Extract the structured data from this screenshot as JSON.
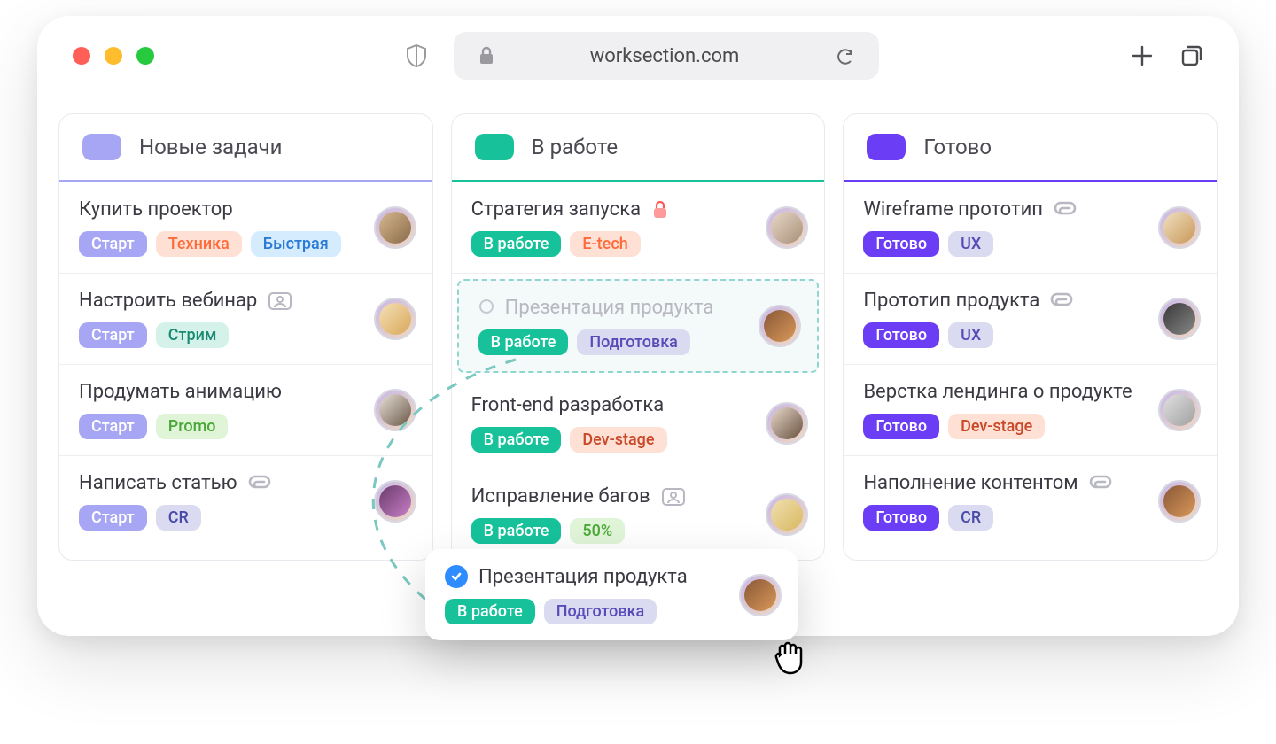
{
  "browser": {
    "url": "worksection.com"
  },
  "columns": [
    {
      "id": "new",
      "title": "Новые задачи",
      "chip_color": "#a6a6f5",
      "border_color": "#a6a6f5",
      "cards": [
        {
          "title": "Купить проектор",
          "tags": [
            {
              "text": "Старт",
              "bg": "#a6a6f5",
              "fg": "#ffffff"
            },
            {
              "text": "Техника",
              "bg": "#ffe0d4",
              "fg": "#ff6a3a"
            },
            {
              "text": "Быстрая",
              "bg": "#d5ecff",
              "fg": "#2a7ad6"
            }
          ],
          "avatar_bg": "linear-gradient(135deg,#d6b890,#8a6a48)"
        },
        {
          "title": "Настроить вебинар",
          "icon": "person-box",
          "tags": [
            {
              "text": "Старт",
              "bg": "#a6a6f5",
              "fg": "#ffffff"
            },
            {
              "text": "Стрим",
              "bg": "#d4f2ea",
              "fg": "#1a8a72"
            }
          ],
          "avatar_bg": "linear-gradient(135deg,#f5e0b8,#d8a858)"
        },
        {
          "title": "Продумать анимацию",
          "tags": [
            {
              "text": "Старт",
              "bg": "#a6a6f5",
              "fg": "#ffffff"
            },
            {
              "text": "Promo",
              "bg": "#e0f4d8",
              "fg": "#4aa838"
            }
          ],
          "avatar_bg": "linear-gradient(135deg,#e8e0d8,#6a5848)"
        },
        {
          "title": "Написать статью",
          "icon": "attach",
          "tags": [
            {
              "text": "Старт",
              "bg": "#a6a6f5",
              "fg": "#ffffff"
            },
            {
              "text": "CR",
              "bg": "#dadaf0",
              "fg": "#4a4aa8"
            }
          ],
          "avatar_bg": "linear-gradient(135deg,#6a3a6a,#c880c8)"
        }
      ]
    },
    {
      "id": "progress",
      "title": "В работе",
      "chip_color": "#17c29b",
      "border_color": "#17c29b",
      "cards": [
        {
          "title": "Стратегия запуска",
          "icon": "lock",
          "tags": [
            {
              "text": "В работе",
              "bg": "#17c29b",
              "fg": "#ffffff"
            },
            {
              "text": "E-tech",
              "bg": "#ffe0d4",
              "fg": "#ff6a3a"
            }
          ],
          "avatar_bg": "linear-gradient(135deg,#e8d8c8,#a89078)"
        },
        {
          "title": "Презентация продукта",
          "ghost": true,
          "tags": [
            {
              "text": "В работе",
              "bg": "#17c29b",
              "fg": "#ffffff"
            },
            {
              "text": "Подготовка",
              "bg": "#dadaf0",
              "fg": "#5a4ab8"
            }
          ],
          "avatar_bg": "linear-gradient(135deg,#8a5838,#d89858)"
        },
        {
          "title": "Front-end разработка",
          "tags": [
            {
              "text": "В работе",
              "bg": "#17c29b",
              "fg": "#ffffff"
            },
            {
              "text": "Dev-stage",
              "bg": "#ffe0d4",
              "fg": "#c84828"
            }
          ],
          "avatar_bg": "linear-gradient(135deg,#e8d8c8,#685040)"
        },
        {
          "title": "Исправление багов",
          "icon": "person-box",
          "tags": [
            {
              "text": "В работе",
              "bg": "#17c29b",
              "fg": "#ffffff"
            },
            {
              "text": "50%",
              "bg": "#e0f4d8",
              "fg": "#4aa838"
            }
          ],
          "avatar_bg": "linear-gradient(135deg,#f0e0b0,#d8b860)"
        }
      ]
    },
    {
      "id": "done",
      "title": "Готово",
      "chip_color": "#6b3df5",
      "border_color": "#6b3df5",
      "cards": [
        {
          "title": "Wireframe прототип",
          "icon": "attach",
          "tags": [
            {
              "text": "Готово",
              "bg": "#6b3df5",
              "fg": "#ffffff"
            },
            {
              "text": "UX",
              "bg": "#dadaf0",
              "fg": "#5a4ab8"
            }
          ],
          "avatar_bg": "linear-gradient(135deg,#f0e0c0,#c89858)"
        },
        {
          "title": "Прототип продукта",
          "icon": "attach",
          "tags": [
            {
              "text": "Готово",
              "bg": "#6b3df5",
              "fg": "#ffffff"
            },
            {
              "text": "UX",
              "bg": "#dadaf0",
              "fg": "#5a4ab8"
            }
          ],
          "avatar_bg": "linear-gradient(135deg,#383838,#888)"
        },
        {
          "title": "Верстка лендинга о продукте",
          "tags": [
            {
              "text": "Готово",
              "bg": "#6b3df5",
              "fg": "#ffffff"
            },
            {
              "text": "Dev-stage",
              "bg": "#ffe0d4",
              "fg": "#c84828"
            }
          ],
          "avatar_bg": "linear-gradient(135deg,#e0e0e0,#a0a0a0)"
        },
        {
          "title": "Наполнение контентом",
          "icon": "attach",
          "tags": [
            {
              "text": "Готово",
              "bg": "#6b3df5",
              "fg": "#ffffff"
            },
            {
              "text": "CR",
              "bg": "#dadaf0",
              "fg": "#4a4aa8"
            }
          ],
          "avatar_bg": "linear-gradient(135deg,#8a5838,#d89858)"
        }
      ]
    }
  ],
  "floating": {
    "title": "Презентация продукта",
    "tags": [
      {
        "text": "В работе",
        "bg": "#17c29b",
        "fg": "#ffffff"
      },
      {
        "text": "Подготовка",
        "bg": "#dadaf0",
        "fg": "#5a4ab8"
      }
    ],
    "avatar_bg": "linear-gradient(135deg,#8a5838,#d89858)"
  }
}
